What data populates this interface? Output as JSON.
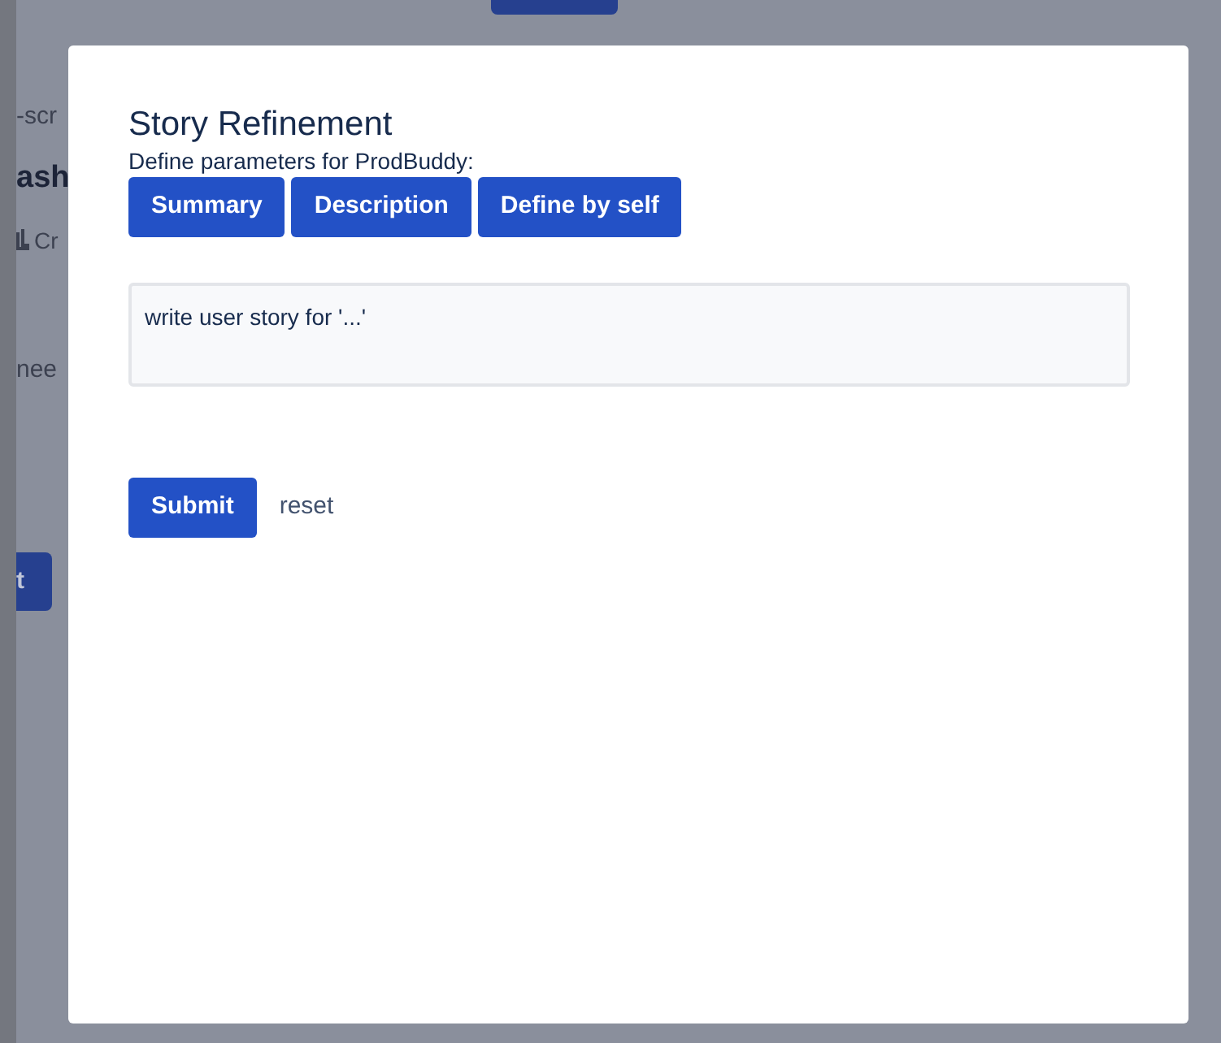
{
  "background_page": {
    "breadcrumb": "-scr",
    "heading": "ash",
    "create_link": "Cr",
    "body_text": "nee",
    "button": "t"
  },
  "dialog": {
    "title": "Story Refinement",
    "subtitle": "Define parameters for ProdBuddy:",
    "presets": [
      {
        "label": "Summary"
      },
      {
        "label": "Description"
      },
      {
        "label": "Define by self"
      }
    ],
    "prompt": {
      "value": "write user story for '...'"
    },
    "submit": "Submit",
    "reset": "reset"
  }
}
